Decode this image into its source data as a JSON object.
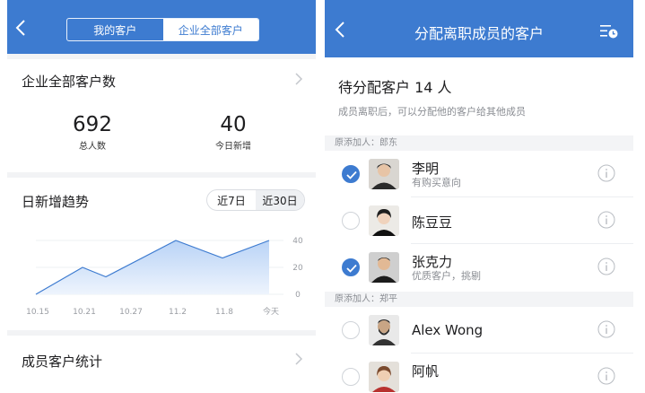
{
  "left": {
    "tabs": [
      {
        "label": "我的客户",
        "active": false
      },
      {
        "label": "企业全部客户",
        "active": true
      }
    ],
    "total_card": {
      "title": "企业全部客户数",
      "stats": [
        {
          "value": "692",
          "label": "总人数"
        },
        {
          "value": "40",
          "label": "今日新增"
        }
      ]
    },
    "trend_card": {
      "title": "日新增趋势",
      "ranges": [
        {
          "label": "近7日",
          "active": false
        },
        {
          "label": "近30日",
          "active": true
        }
      ]
    },
    "members_card": {
      "title": "成员客户统计"
    }
  },
  "chart_data": {
    "type": "area",
    "categories": [
      "10.15",
      "10.21",
      "10.27",
      "11.2",
      "11.8",
      "今天"
    ],
    "x_ticks": [
      "10.15",
      "10.21",
      "10.27",
      "11.2",
      "11.8",
      "今天"
    ],
    "y_ticks": [
      "40",
      "20",
      "0"
    ],
    "ylim": [
      0,
      40
    ],
    "points": [
      {
        "x": "10.15",
        "y": 0
      },
      {
        "x": "10.21",
        "y": 20
      },
      {
        "x": "10.24",
        "y": 13
      },
      {
        "x": "11.2",
        "y": 40
      },
      {
        "x": "11.8",
        "y": 27
      },
      {
        "x": "今天",
        "y": 40
      }
    ],
    "colors": {
      "line": "#3d7bd0",
      "fill": "#d6e6fb",
      "axis_text": "#9a9da3"
    }
  },
  "right": {
    "title": "分配离职成员的客户",
    "pending": "待分配客户 14 人",
    "pending_sub": "成员离职后，可以分配他的客户给其他成员",
    "groups": [
      {
        "label": "原添加人：郎东",
        "members": [
          {
            "name": "李明",
            "note": "有购买意向",
            "checked": true
          },
          {
            "name": "陈豆豆",
            "note": "",
            "checked": false
          },
          {
            "name": "张克力",
            "note": "优质客户，挑剔",
            "checked": true
          }
        ]
      },
      {
        "label": "原添加人：郑平",
        "members": [
          {
            "name": "Alex Wong",
            "note": "",
            "checked": false
          },
          {
            "name": "阿帆",
            "note": "",
            "checked": false
          }
        ]
      }
    ]
  },
  "colors": {
    "brand_blue": "#3d7bd0",
    "page_bg": "#f2f3f5"
  }
}
